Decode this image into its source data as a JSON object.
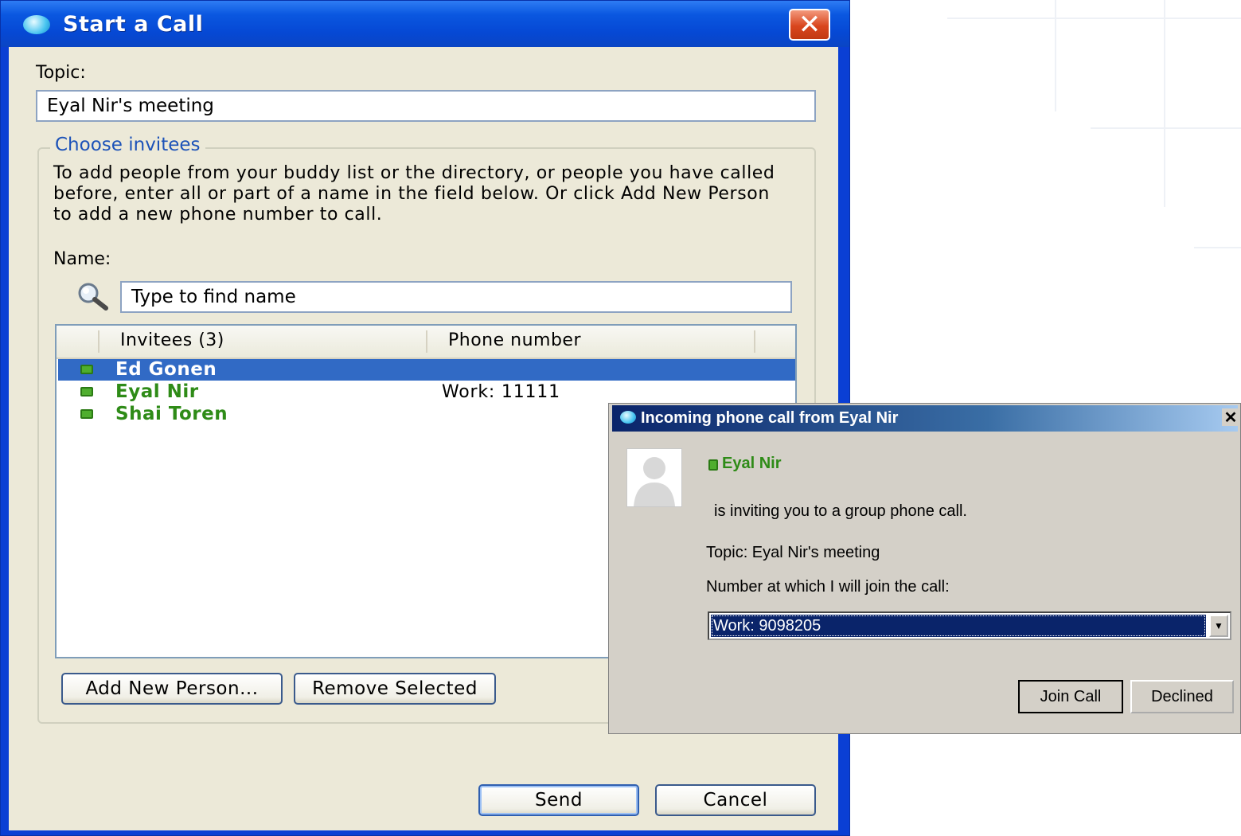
{
  "start_call": {
    "title": "Start a Call",
    "topic_label": "Topic:",
    "topic_value": "Eyal Nir's meeting",
    "group_title": "Choose invitees",
    "help_text": "To add people from your buddy list or the directory, or people you have called before, enter all or part of a name in the field below.  Or click Add New Person to add a new phone number to call.",
    "name_label": "Name:",
    "name_placeholder": "Type to find name",
    "columns": [
      "Invitees (3)",
      "Phone number"
    ],
    "invitees": [
      {
        "name": "Ed Gonen",
        "phone": "",
        "selected": true
      },
      {
        "name": "Eyal Nir",
        "phone": "Work: 11111",
        "selected": false
      },
      {
        "name": "Shai Toren",
        "phone": "",
        "selected": false
      }
    ],
    "add_button": "Add New Person...",
    "remove_button": "Remove Selected",
    "send_button": "Send",
    "cancel_button": "Cancel",
    "close_symbol": "✕"
  },
  "incoming_call": {
    "title": "Incoming phone call from Eyal Nir",
    "caller": "Eyal Nir",
    "message": "is inviting you to a group phone call.",
    "topic_line": "Topic: Eyal Nir's meeting",
    "number_label": "Number at which I will join the call:",
    "number_value": "Work: 9098205",
    "join_button": "Join Call",
    "decline_button": "Declined",
    "close_symbol": "✕"
  },
  "colors": {
    "xp_title_blue": "#0648d4",
    "selection_blue": "#316ac5",
    "presence_green": "#4fae2e",
    "name_green": "#2e8b17",
    "link_blue": "#1c52b8"
  },
  "icons": [
    "chat-bubble-icon",
    "close-icon",
    "search-icon",
    "presence-online-icon",
    "avatar-placeholder-icon",
    "dropdown-arrow-icon"
  ]
}
